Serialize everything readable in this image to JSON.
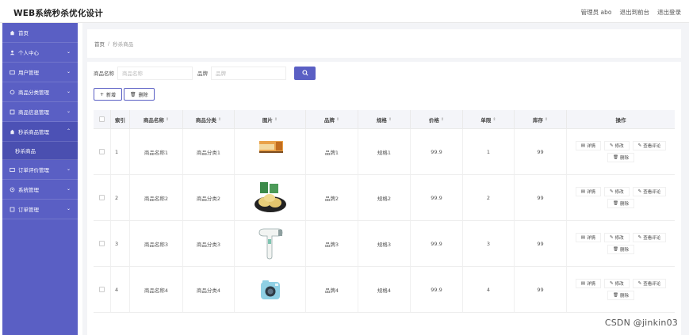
{
  "app": {
    "title": "WEB系统秒杀优化设计"
  },
  "header": {
    "admin_label": "管理员 abo",
    "back_label": "退出到前台",
    "logout_label": "退出登录"
  },
  "sidebar": {
    "items": [
      {
        "label": "首页",
        "icon": "home-icon",
        "has_chevron": false
      },
      {
        "label": "个人中心",
        "icon": "user-icon",
        "has_chevron": true
      },
      {
        "label": "用户管理",
        "icon": "users-icon",
        "has_chevron": true
      },
      {
        "label": "商品分类管理",
        "icon": "category-icon",
        "has_chevron": true
      },
      {
        "label": "商品信息管理",
        "icon": "goods-icon",
        "has_chevron": true
      },
      {
        "label": "秒杀商品管理",
        "icon": "flash-sale-icon",
        "has_chevron": true,
        "expanded": true
      },
      {
        "label": "订单评价管理",
        "icon": "comment-icon",
        "has_chevron": true
      },
      {
        "label": "系统管理",
        "icon": "settings-icon",
        "has_chevron": true
      },
      {
        "label": "订单管理",
        "icon": "order-icon",
        "has_chevron": true
      }
    ],
    "submenu": {
      "label": "秒杀商品"
    }
  },
  "breadcrumb": {
    "home": "首页",
    "separator": "/",
    "current": "秒杀商品"
  },
  "search": {
    "name_label": "商品名称",
    "name_placeholder": "商品名称",
    "brand_label": "品牌",
    "brand_placeholder": "品牌"
  },
  "actions": {
    "add_label": "新增",
    "delete_label": "删除"
  },
  "table": {
    "headers": [
      "索引",
      "商品名称",
      "商品分类",
      "图片",
      "品牌",
      "规格",
      "价格",
      "单限",
      "库存",
      "操作"
    ],
    "rows": [
      {
        "index": "1",
        "name": "商品名称1",
        "category": "商品分类1",
        "image": "food-package-icon",
        "brand": "品牌1",
        "spec": "规格1",
        "price": "99.9",
        "limit": "1",
        "stock": "99"
      },
      {
        "index": "2",
        "name": "商品名称2",
        "category": "商品分类2",
        "image": "bread-plate-icon",
        "brand": "品牌2",
        "spec": "规格2",
        "price": "99.9",
        "limit": "2",
        "stock": "99"
      },
      {
        "index": "3",
        "name": "商品名称3",
        "category": "商品分类3",
        "image": "hair-dryer-icon",
        "brand": "品牌3",
        "spec": "规格3",
        "price": "99.9",
        "limit": "3",
        "stock": "99"
      },
      {
        "index": "4",
        "name": "商品名称4",
        "category": "商品分类4",
        "image": "camera-icon",
        "brand": "品牌4",
        "spec": "规格4",
        "price": "99.9",
        "limit": "4",
        "stock": "99"
      }
    ],
    "row_ops": {
      "detail": "详情",
      "edit": "修改",
      "review": "查看评论",
      "delete": "删除"
    }
  },
  "colors": {
    "sidebar": "#5a5fc4",
    "accent": "#5a5fc4"
  },
  "watermark": "CSDN @jinkin03"
}
